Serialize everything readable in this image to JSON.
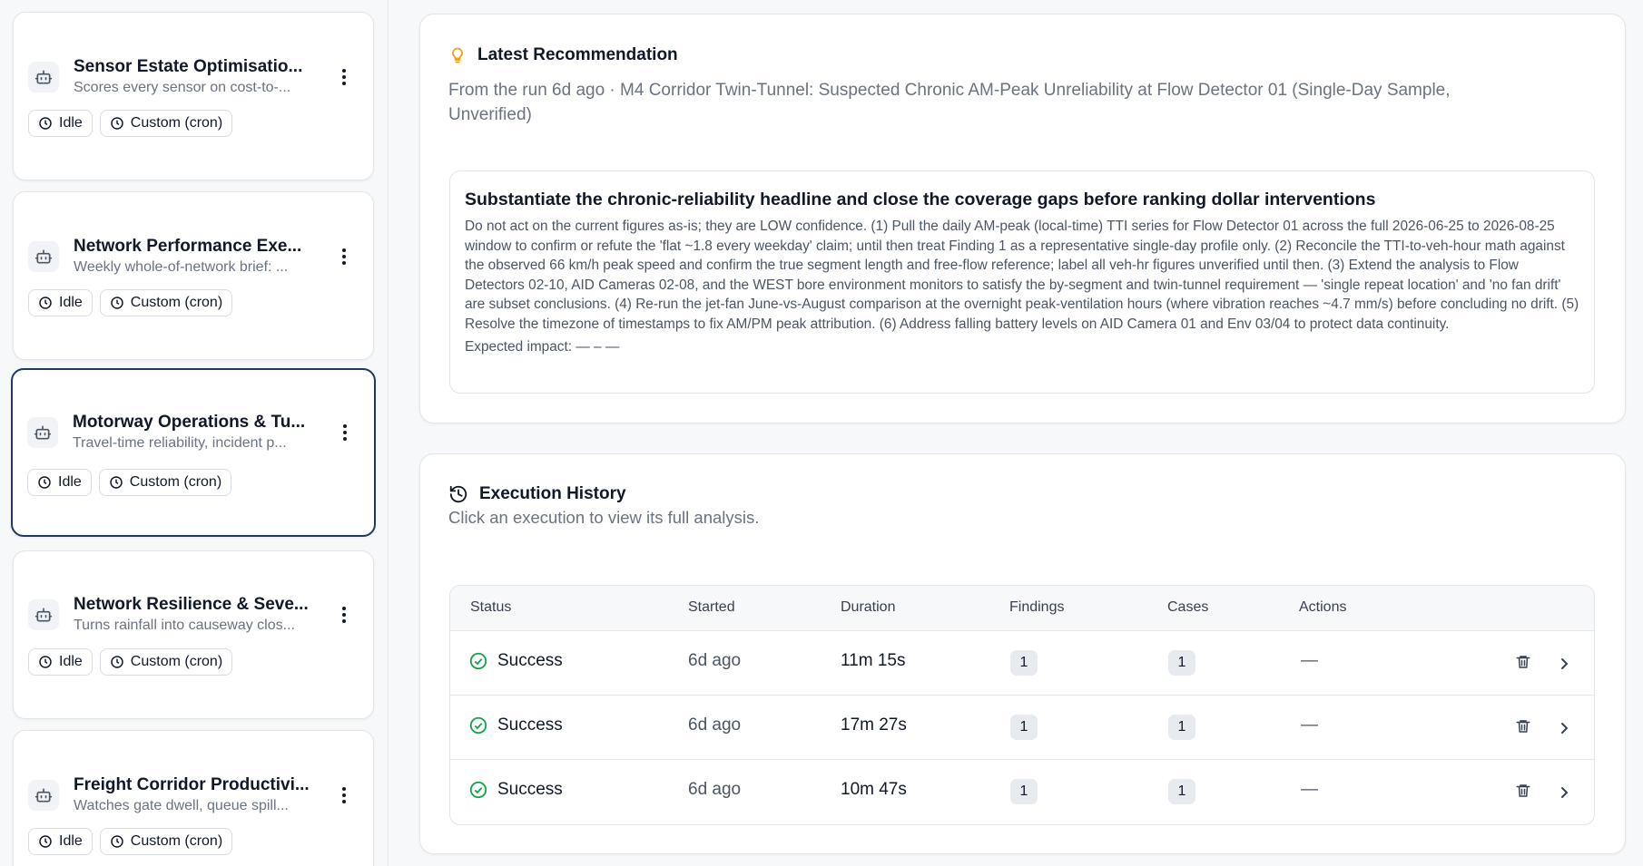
{
  "sidebar": {
    "agents": [
      {
        "title": "Sensor Estate Optimisatio...",
        "subtitle": "Scores every sensor on cost-to-...",
        "status": "Idle",
        "schedule": "Custom (cron)"
      },
      {
        "title": "Network Performance Exe...",
        "subtitle": "Weekly whole-of-network brief: ...",
        "status": "Idle",
        "schedule": "Custom (cron)"
      },
      {
        "title": "Motorway Operations & Tu...",
        "subtitle": "Travel-time reliability, incident p...",
        "status": "Idle",
        "schedule": "Custom (cron)"
      },
      {
        "title": "Network Resilience & Seve...",
        "subtitle": "Turns rainfall into causeway clos...",
        "status": "Idle",
        "schedule": "Custom (cron)"
      },
      {
        "title": "Freight Corridor Productivi...",
        "subtitle": "Watches gate dwell, queue spill...",
        "status": "Idle",
        "schedule": "Custom (cron)"
      }
    ]
  },
  "recommendation": {
    "title": "Latest Recommendation",
    "source": "From the run 6d ago · M4 Corridor Twin-Tunnel: Suspected Chronic AM-Peak Unreliability at Flow Detector 01 (Single-Day Sample, Unverified)",
    "headline": "Substantiate the chronic-reliability headline and close the coverage gaps before ranking dollar interventions",
    "body": "Do not act on the current figures as-is; they are LOW confidence. (1) Pull the daily AM-peak (local-time) TTI series for Flow Detector 01 across the full 2026-06-25 to 2026-08-25 window to confirm or refute the 'flat ~1.8 every weekday' claim; until then treat Finding 1 as a representative single-day profile only. (2) Reconcile the TTI-to-veh-hour math against the observed 66 km/h peak speed and confirm the true segment length and free-flow reference; label all veh-hr figures unverified until then. (3) Extend the analysis to Flow Detectors 02-10, AID Cameras 02-08, and the WEST bore environment monitors to satisfy the by-segment and twin-tunnel requirement — 'single repeat location' and 'no fan drift' are subset conclusions. (4) Re-run the jet-fan June-vs-August comparison at the overnight peak-ventilation hours (where vibration reaches ~4.7 mm/s) before concluding no drift. (5) Resolve the timezone of timestamps to fix AM/PM peak attribution. (6) Address falling battery levels on AID Camera 01 and Env 03/04 to protect data continuity.",
    "impact": "Expected impact: — – —"
  },
  "history": {
    "title": "Execution History",
    "subtitle": "Click an execution to view its full analysis.",
    "columns": [
      "Status",
      "Started",
      "Duration",
      "Findings",
      "Cases",
      "Actions"
    ],
    "rows": [
      {
        "status": "Success",
        "started": "6d ago",
        "duration": "11m 15s",
        "findings": "1",
        "cases": "1",
        "actions": "—"
      },
      {
        "status": "Success",
        "started": "6d ago",
        "duration": "17m 27s",
        "findings": "1",
        "cases": "1",
        "actions": "—"
      },
      {
        "status": "Success",
        "started": "6d ago",
        "duration": "10m 47s",
        "findings": "1",
        "cases": "1",
        "actions": "—"
      }
    ]
  },
  "colors": {
    "selected_border": "#1f3a5f",
    "success": "#16a34a",
    "lightbulb": "#f59e0b"
  }
}
